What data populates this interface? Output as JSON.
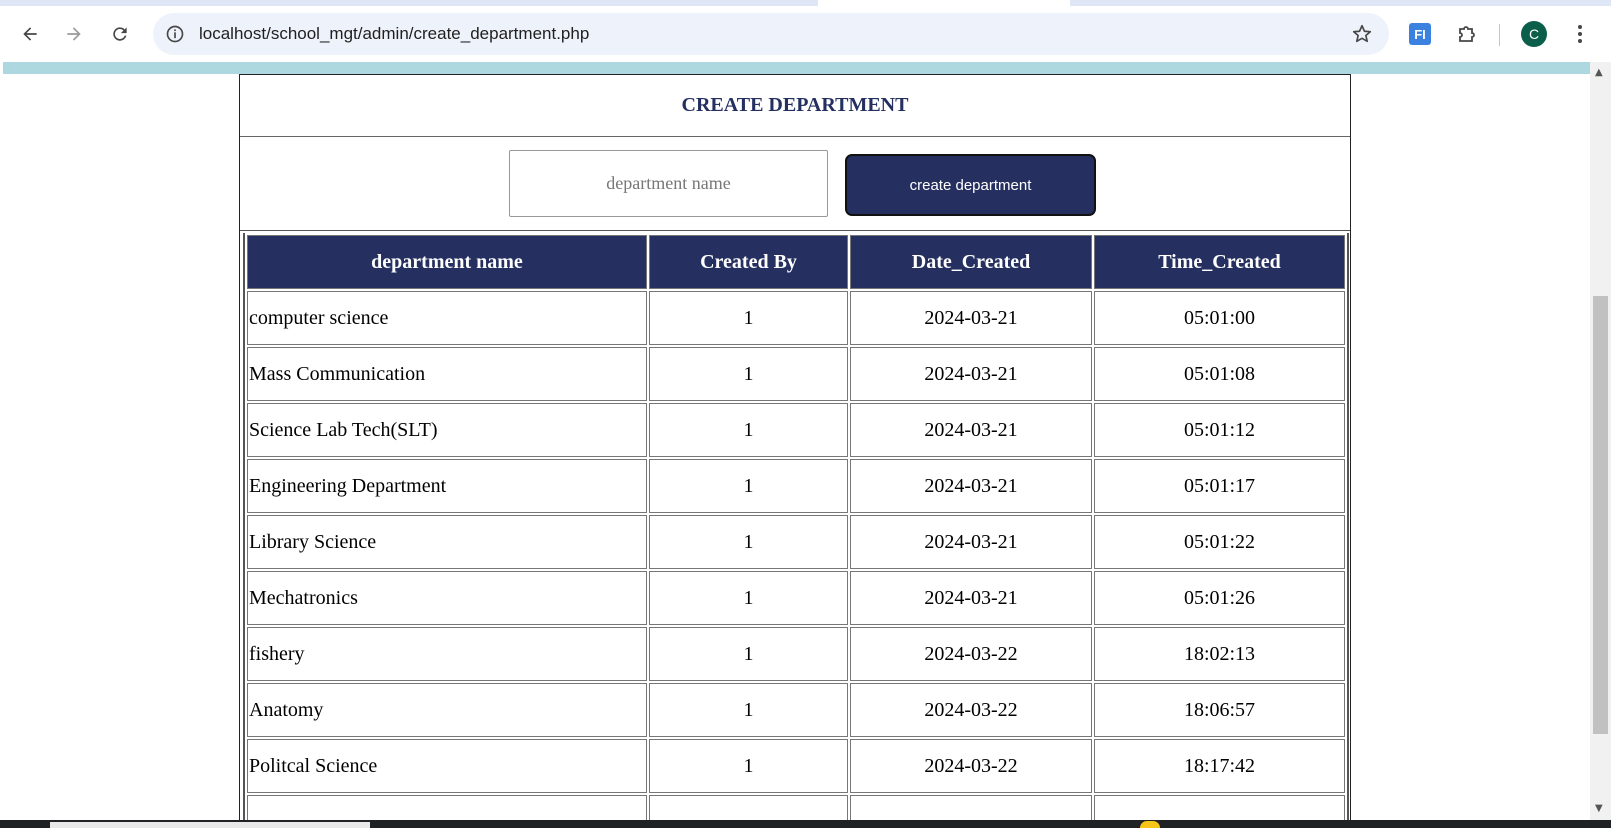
{
  "browser": {
    "url": "localhost/school_mgt/admin/create_department.php",
    "extension_label": "FI",
    "profile_initial": "C"
  },
  "page": {
    "title": "CREATE DEPARTMENT",
    "input_placeholder": "department name",
    "create_button_label": "create department"
  },
  "table": {
    "headers": [
      "department name",
      "Created By",
      "Date_Created",
      "Time_Created"
    ],
    "rows": [
      [
        "computer science",
        "1",
        "2024-03-21",
        "05:01:00"
      ],
      [
        "Mass Communication",
        "1",
        "2024-03-21",
        "05:01:08"
      ],
      [
        "Science Lab Tech(SLT)",
        "1",
        "2024-03-21",
        "05:01:12"
      ],
      [
        "Engineering Department",
        "1",
        "2024-03-21",
        "05:01:17"
      ],
      [
        "Library Science",
        "1",
        "2024-03-21",
        "05:01:22"
      ],
      [
        "Mechatronics",
        "1",
        "2024-03-21",
        "05:01:26"
      ],
      [
        "fishery",
        "1",
        "2024-03-22",
        "18:02:13"
      ],
      [
        "Anatomy",
        "1",
        "2024-03-22",
        "18:06:57"
      ],
      [
        "Politcal Science",
        "1",
        "2024-03-22",
        "18:17:42"
      ]
    ]
  },
  "colors": {
    "accent": "#253061",
    "top_band": "#aed8e0"
  }
}
